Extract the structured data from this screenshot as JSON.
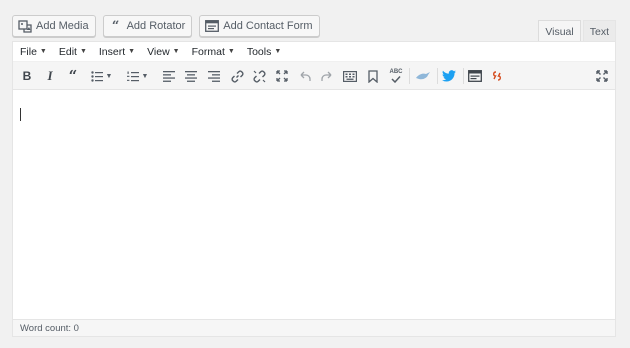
{
  "media_buttons": [
    {
      "label": "Add Media",
      "icon": "media-icon"
    },
    {
      "label": "Add Rotator",
      "icon": "quote-icon"
    },
    {
      "label": "Add Contact Form",
      "icon": "form-icon"
    }
  ],
  "mode_tabs": [
    {
      "label": "Visual",
      "active": true
    },
    {
      "label": "Text",
      "active": false
    }
  ],
  "menubar": [
    {
      "label": "File"
    },
    {
      "label": "Edit"
    },
    {
      "label": "Insert"
    },
    {
      "label": "View"
    },
    {
      "label": "Format"
    },
    {
      "label": "Tools"
    }
  ],
  "toolbar": {
    "items": [
      "bold-icon",
      "italic-icon",
      "blockquote-icon",
      "bullet-list-icon",
      "numbered-list-icon",
      "align-left-icon",
      "align-center-icon",
      "align-right-icon",
      "link-icon",
      "unlink-icon",
      "fullscreen-icon",
      "undo-icon",
      "redo-icon",
      "keyboard-icon",
      "bookmark-icon",
      "spellcheck-icon",
      "bird-icon",
      "twitter-icon",
      "template-icon",
      "shortcode-icon",
      "expand-icon"
    ],
    "spellcheck_text": "ABC",
    "accent_colors": {
      "twitter": "#1da1f2",
      "bird": "#8fb7d9",
      "shortcode": "#d54e21"
    }
  },
  "status": {
    "word_count": "Word count: 0"
  }
}
